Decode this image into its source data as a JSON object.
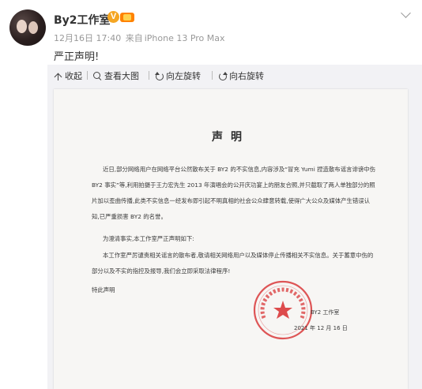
{
  "post": {
    "username": "By2工作室",
    "verified_badge": "V",
    "timestamp": "12月16日 17:40",
    "source_prefix": "来自",
    "source": "iPhone 13 Pro Max",
    "text": "严正声明!"
  },
  "toolbar": {
    "collapse_label": "收起",
    "view_large_label": "查看大图",
    "rotate_left_label": "向左旋转",
    "rotate_right_label": "向右旋转"
  },
  "document": {
    "title": "声明",
    "paragraph_1": "近日,部分网络用户在网络平台公然散布关于 BY2 的不实信息,内容涉及“冒充 Yumi 捏造散布谣言诽谤中伤 BY2 事实”等,利用拍摄于王力宏先生 2013 年演唱会的公开庆功宴上的朋友合照,并只截取了两人单独部分的照片加以歪曲传播,此类不实信息一经发布即引起不明真相的社会公众肆意转载,使得广大公众及媒体产生错误认知,已严重损害 BY2 的名誉。",
    "paragraph_2": "为澄清事实,本工作室严正声明如下:",
    "paragraph_3": "本工作室严厉谴责相关谣言的散布者,敬请相关网络用户以及媒体停止传播相关不实信息。关于蓄意中伤的部分以及不实的指控及报导,我们会立即采取法律程序!",
    "paragraph_4": "特此声明",
    "signature_org": "BY2 工作室",
    "signature_date": "2021 年 12 月 16 日",
    "seal_text": "北京工作室"
  },
  "icons": {
    "chevron": "chevron-down-icon",
    "collapse": "collapse-icon",
    "zoom": "zoom-icon",
    "rotate_left": "rotate-left-icon",
    "rotate_right": "rotate-right-icon"
  },
  "colors": {
    "meta_text": "#999999",
    "toolbar_bg": "#f2f2f5",
    "seal_red": "#d9383a",
    "verified_orange": "#f5a623"
  }
}
